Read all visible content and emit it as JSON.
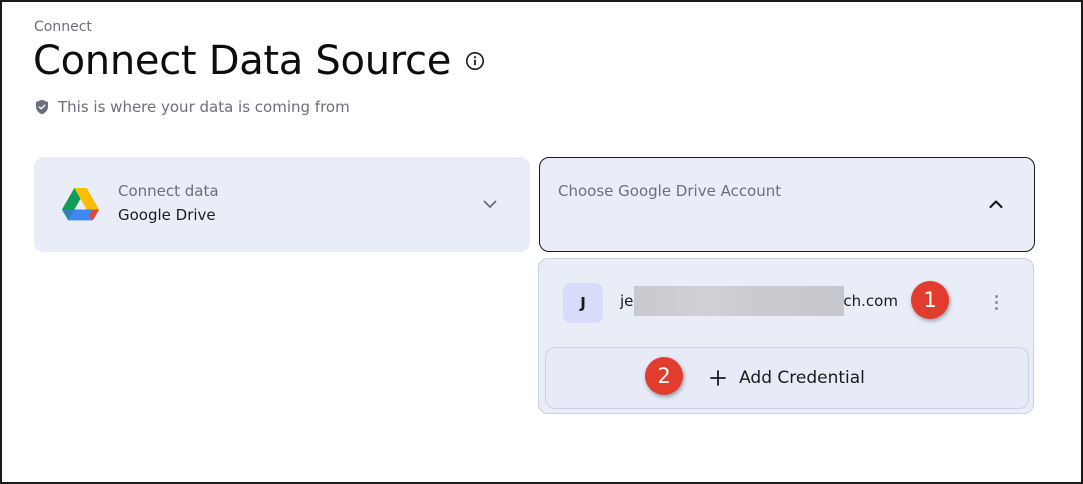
{
  "header": {
    "breadcrumb": "Connect",
    "title": "Connect Data Source",
    "subtitle": "This is where your data is coming from",
    "icons": {
      "info": "info-icon",
      "shield": "shield-icon"
    }
  },
  "source": {
    "label": "Connect data",
    "value": "Google Drive",
    "icon": "google-drive-icon"
  },
  "account_select": {
    "placeholder": "Choose Google Drive Account",
    "expanded": true
  },
  "dropdown": {
    "accounts": [
      {
        "avatar": "J",
        "email_prefix": "je",
        "email_suffix": "ch.com",
        "redacted": true
      }
    ],
    "add_label": "Add Credential"
  },
  "callouts": [
    "1",
    "2"
  ],
  "colors": {
    "card_bg": "#e8edf8",
    "callout": "#e23c2e",
    "avatar_bg": "#d7dcf8",
    "muted_text": "#6b6f7b"
  }
}
